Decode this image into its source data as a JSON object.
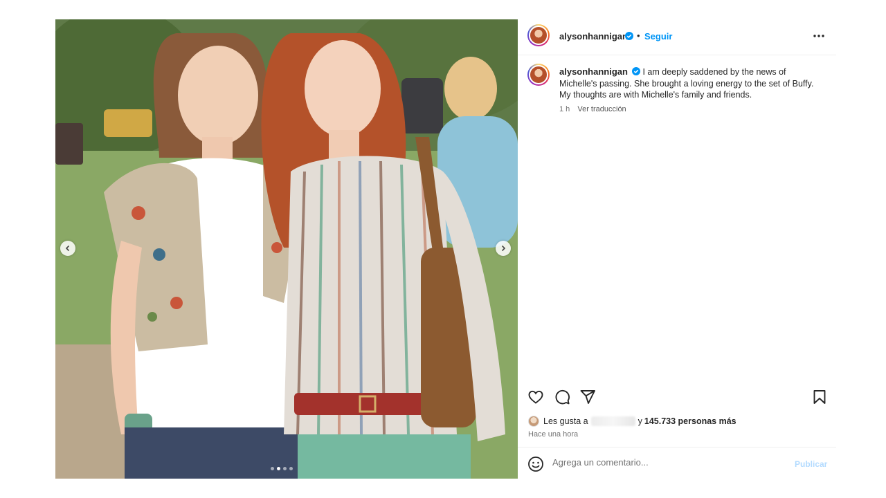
{
  "post": {
    "author": {
      "username": "alysonhannigan",
      "verified": true,
      "follow_label": "Seguir",
      "separator": "•"
    },
    "more_options_icon": "ellipsis-icon",
    "caption": {
      "username": "alysonhannigan",
      "text": "I am deeply saddened by the news of Michelle's passing. She brought a loving energy to the set of Buffy. My thoughts are with Michelle's family and friends.",
      "age": "1 h",
      "translate_label": "Ver traducción"
    },
    "media": {
      "carousel_total": 4,
      "carousel_active": 2,
      "prev_icon": "chevron-left-icon",
      "next_icon": "chevron-right-icon"
    },
    "actions": {
      "like_icon": "heart-icon",
      "comment_icon": "comment-icon",
      "share_icon": "paper-plane-icon",
      "save_icon": "bookmark-icon"
    },
    "likes": {
      "prefix": "Les gusta a",
      "suffix_connector": "y",
      "count_text": "145.733 personas más"
    },
    "posted_ago": "Hace una hora",
    "comment_box": {
      "emoji_icon": "smiley-icon",
      "placeholder": "Agrega un comentario...",
      "publish_label": "Publicar"
    },
    "colors": {
      "link_blue": "#0095f6",
      "publish_disabled": "#b3dbff",
      "verified_blue": "#0095f6",
      "text_primary": "#262626",
      "text_secondary": "#737373"
    }
  }
}
